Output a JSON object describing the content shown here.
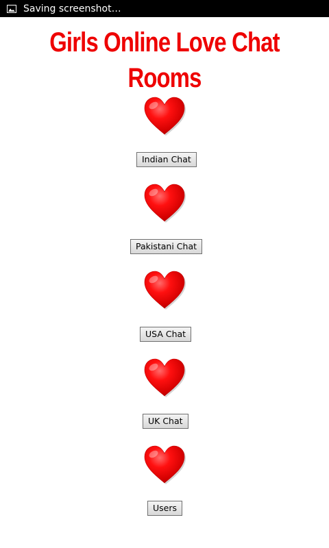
{
  "status_bar": {
    "notification_text": "Saving screenshot…",
    "icon": "image-icon"
  },
  "app": {
    "title": "Girls Online Love Chat Rooms",
    "title_color": "#ee0000"
  },
  "rooms": [
    {
      "icon": "heart-icon",
      "label": "Indian Chat"
    },
    {
      "icon": "heart-icon",
      "label": "Pakistani Chat"
    },
    {
      "icon": "heart-icon",
      "label": "USA Chat"
    },
    {
      "icon": "heart-icon",
      "label": "UK Chat"
    },
    {
      "icon": "heart-icon",
      "label": "Users"
    }
  ],
  "colors": {
    "heart": "#ff0000",
    "status_bar_bg": "#000000"
  }
}
